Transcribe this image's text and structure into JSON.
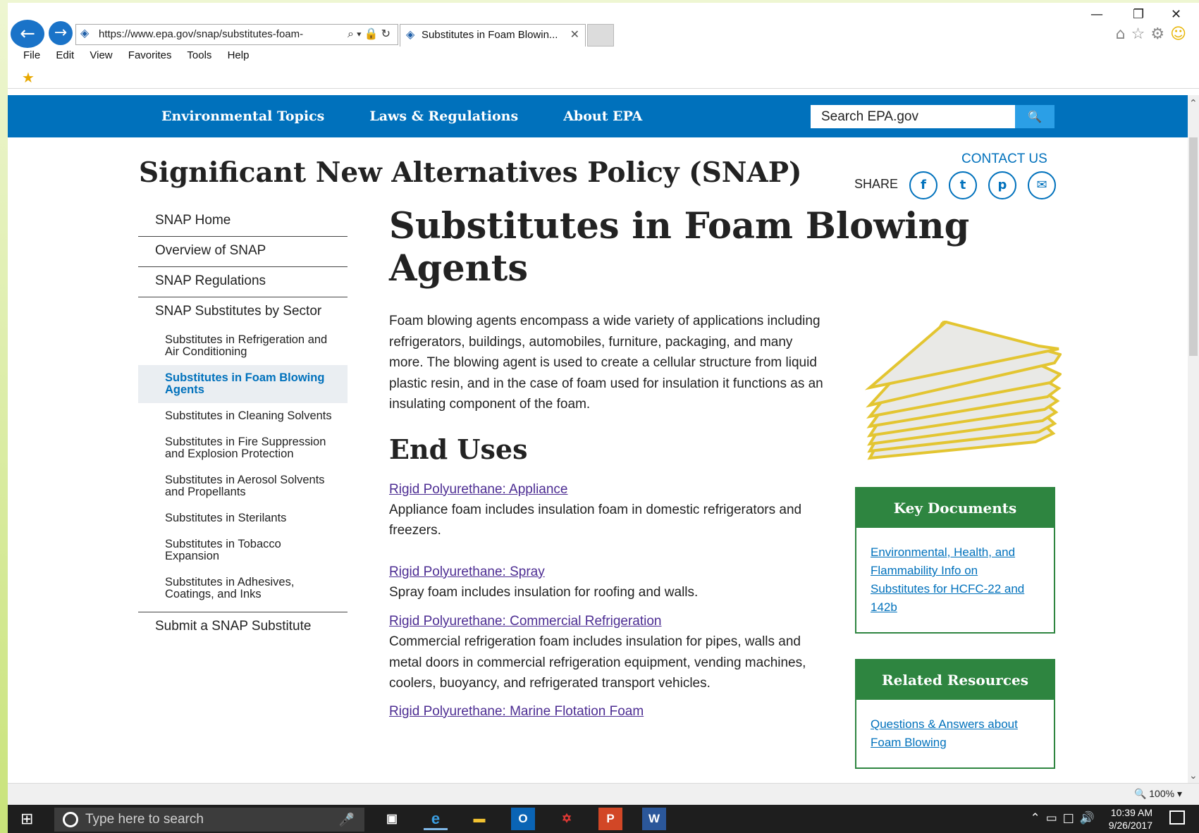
{
  "browser": {
    "url": "https://www.epa.gov/snap/substitutes-foam-",
    "tab_title": "Substitutes in Foam Blowin...",
    "menu": [
      "File",
      "Edit",
      "View",
      "Favorites",
      "Tools",
      "Help"
    ],
    "zoom": "100%"
  },
  "epa_nav": {
    "items": [
      "Environmental Topics",
      "Laws & Regulations",
      "About EPA"
    ],
    "search_placeholder": "Search EPA.gov"
  },
  "header": {
    "site_title": "Significant New Alternatives Policy (SNAP)",
    "contact": "CONTACT US",
    "share": "SHARE"
  },
  "sidebar": {
    "top_items": [
      "SNAP Home",
      "Overview of SNAP",
      "SNAP Regulations",
      "SNAP Substitutes by Sector"
    ],
    "sub_items": [
      "Substitutes in Refrigeration and Air Conditioning",
      "Substitutes in Foam Blowing Agents",
      "Substitutes in Cleaning Solvents",
      "Substitutes in Fire Suppression and Explosion Protection",
      "Substitutes in Aerosol Solvents and Propellants",
      "Substitutes in Sterilants",
      "Substitutes in Tobacco Expansion",
      "Substitutes in Adhesives, Coatings, and Inks"
    ],
    "last_item": "Submit a SNAP Substitute"
  },
  "main": {
    "title": "Substitutes in Foam Blowing Agents",
    "intro": "Foam blowing agents encompass a wide variety of applications including refrigerators, buildings, automobiles, furniture, packaging, and many more. The blowing agent is used to create a cellular structure from liquid plastic resin, and in the case of foam used for insulation it functions as an insulating component of the foam.",
    "end_uses_heading": "End Uses",
    "end_uses": [
      {
        "link": "Rigid Polyurethane: Appliance",
        "desc": "Appliance foam includes insulation foam in domestic refrigerators and freezers."
      },
      {
        "link": "Rigid Polyurethane: Spray",
        "desc": "Spray foam includes insulation for roofing and walls."
      },
      {
        "link": "Rigid Polyurethane: Commercial Refrigeration",
        "desc": "Commercial refrigeration foam includes insulation for pipes, walls and metal doors in commercial refrigeration equipment, vending machines, coolers, buoyancy, and refrigerated transport vehicles."
      },
      {
        "link": "Rigid Polyurethane: Marine Flotation Foam",
        "desc": ""
      }
    ]
  },
  "key_documents": {
    "heading": "Key Documents",
    "link": "Environmental, Health, and Flammability Info on Substitutes for HCFC-22 and 142b"
  },
  "related_resources": {
    "heading": "Related Resources",
    "link": "Questions & Answers about Foam Blowing"
  },
  "taskbar": {
    "search_placeholder": "Type here to search",
    "time": "10:39 AM",
    "date": "9/26/2017"
  }
}
